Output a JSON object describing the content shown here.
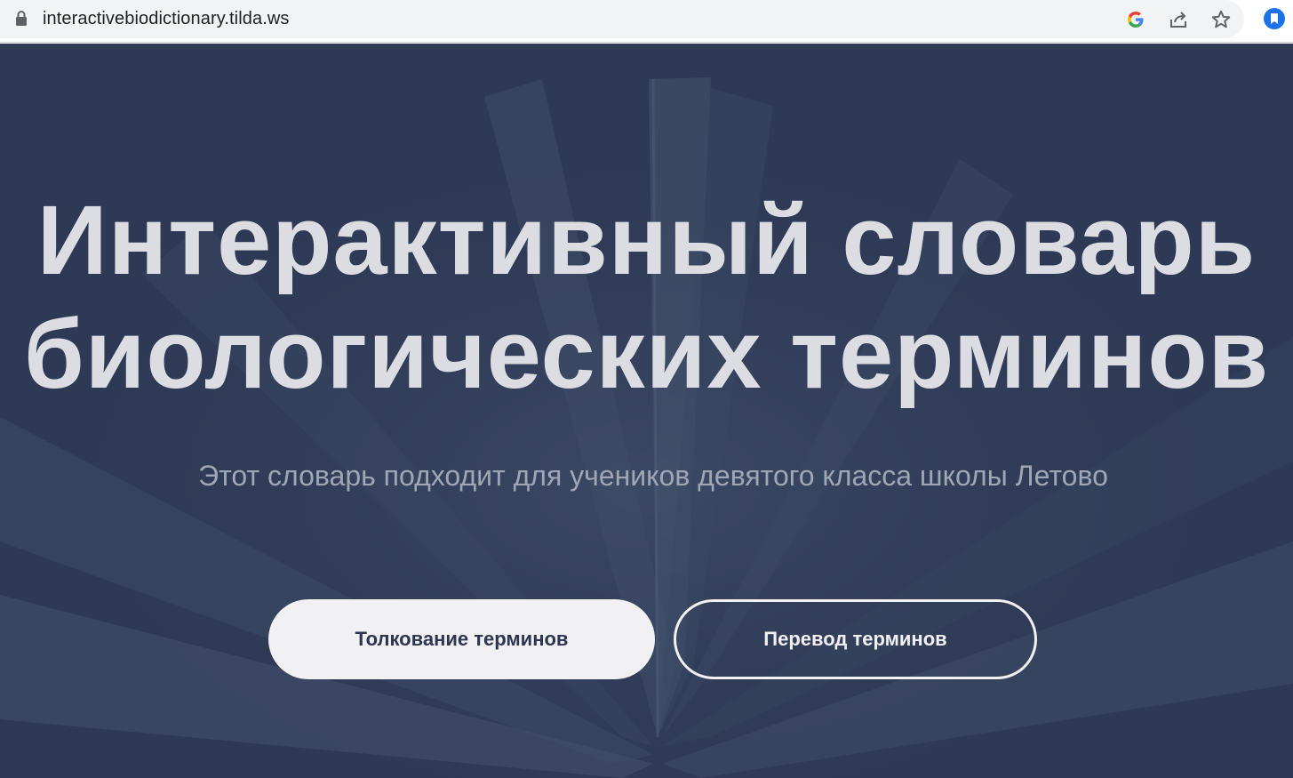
{
  "browser": {
    "url": "interactivebiodictionary.tilda.ws",
    "icons": [
      "lock-icon",
      "google-icon",
      "share-icon",
      "bookmark-star-icon",
      "extension-icon"
    ]
  },
  "hero": {
    "title_line1": "Интерактивный словарь",
    "title_line2": "биологических терминов",
    "subtitle": "Этот словарь подходит для учеников девятого класса школы Летово",
    "buttons": {
      "primary_label": "Толкование терминов",
      "secondary_label": "Перевод терминов"
    }
  },
  "colors": {
    "background": "#2e3a55",
    "title": "#dcdde2",
    "subtitle": "#9fa6b5",
    "button_fill": "#f1f1f3",
    "button_text": "#2d3550"
  }
}
